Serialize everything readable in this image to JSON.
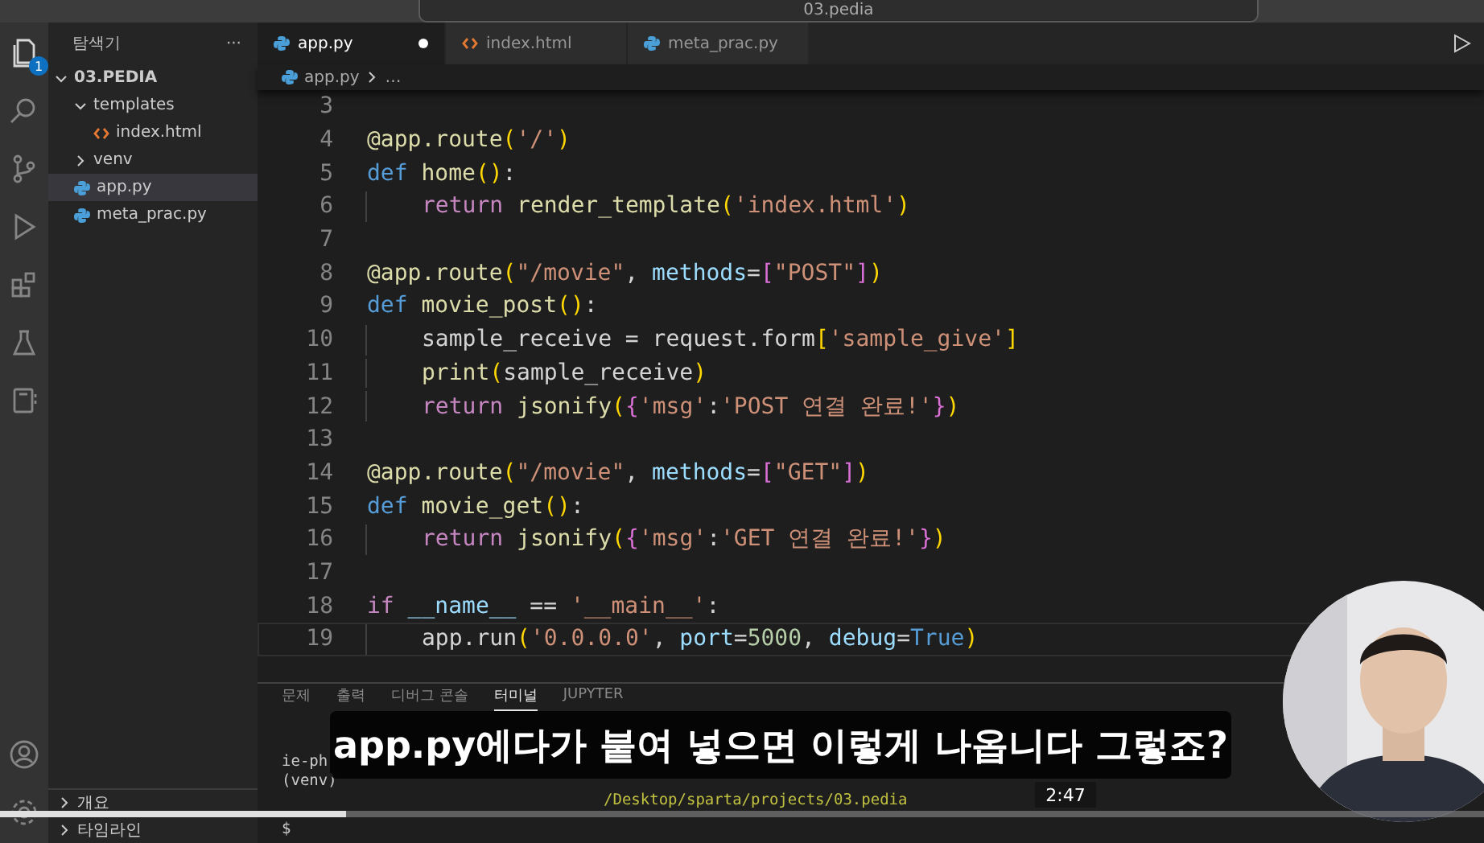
{
  "search": {
    "text": "03.pedia"
  },
  "activity_bar": {
    "badge": "1"
  },
  "explorer": {
    "title": "탐색기",
    "more": "···",
    "tree": [
      {
        "label": "03.PEDIA",
        "kind": "root",
        "expanded": true,
        "selected": false,
        "children": [
          {
            "label": "templates",
            "kind": "folder",
            "expanded": true,
            "selected": false,
            "children": [
              {
                "label": "index.html",
                "kind": "html",
                "selected": false
              }
            ]
          },
          {
            "label": "venv",
            "kind": "folder",
            "expanded": false,
            "selected": false
          },
          {
            "label": "app.py",
            "kind": "python",
            "selected": true
          },
          {
            "label": "meta_prac.py",
            "kind": "python",
            "selected": false
          }
        ]
      }
    ],
    "sections": [
      {
        "label": "개요"
      },
      {
        "label": "타임라인"
      }
    ]
  },
  "tabs": [
    {
      "label": "app.py",
      "kind": "python",
      "selected": true,
      "modified": true
    },
    {
      "label": "index.html",
      "kind": "html",
      "selected": false,
      "modified": false
    },
    {
      "label": "meta_prac.py",
      "kind": "python",
      "selected": false,
      "modified": false
    }
  ],
  "breadcrumb": {
    "file": "app.py",
    "rest": "…"
  },
  "code": [
    {
      "number": "3",
      "indent": false,
      "current": false
    },
    {
      "number": "4",
      "indent": false,
      "current": false,
      "tokens": [
        {
          "kind": "func",
          "text": "@app.route"
        },
        {
          "kind": "bracket",
          "text": "("
        },
        {
          "kind": "string",
          "text": "'/'"
        },
        {
          "kind": "bracket",
          "text": ")"
        }
      ]
    },
    {
      "number": "5",
      "indent": false,
      "current": false,
      "tokens": [
        {
          "kind": "keyword",
          "text": "def "
        },
        {
          "kind": "func",
          "text": "home"
        },
        {
          "kind": "bracket",
          "text": "()"
        },
        {
          "kind": "plain",
          "text": ":"
        }
      ]
    },
    {
      "number": "6",
      "indent": true,
      "current": false,
      "tokens": [
        {
          "kind": "control",
          "text": "return "
        },
        {
          "kind": "func",
          "text": "render_template"
        },
        {
          "kind": "bracket",
          "text": "("
        },
        {
          "kind": "string",
          "text": "'index.html'"
        },
        {
          "kind": "bracket",
          "text": ")"
        }
      ]
    },
    {
      "number": "7",
      "indent": false,
      "current": false
    },
    {
      "number": "8",
      "indent": false,
      "current": false,
      "tokens": [
        {
          "kind": "func",
          "text": "@app.route"
        },
        {
          "kind": "bracket",
          "text": "("
        },
        {
          "kind": "string",
          "text": "\"/movie\""
        },
        {
          "kind": "plain",
          "text": ", "
        },
        {
          "kind": "param",
          "text": "methods"
        },
        {
          "kind": "plain",
          "text": "="
        },
        {
          "kind": "bracket2",
          "text": "["
        },
        {
          "kind": "string",
          "text": "\"POST\""
        },
        {
          "kind": "bracket2",
          "text": "]"
        },
        {
          "kind": "bracket",
          "text": ")"
        }
      ]
    },
    {
      "number": "9",
      "indent": false,
      "current": false,
      "tokens": [
        {
          "kind": "keyword",
          "text": "def "
        },
        {
          "kind": "func",
          "text": "movie_post"
        },
        {
          "kind": "bracket",
          "text": "()"
        },
        {
          "kind": "plain",
          "text": ":"
        }
      ]
    },
    {
      "number": "10",
      "indent": true,
      "current": false,
      "tokens": [
        {
          "kind": "plain",
          "text": "sample_receive = request.form"
        },
        {
          "kind": "bracket",
          "text": "["
        },
        {
          "kind": "string",
          "text": "'sample_give'"
        },
        {
          "kind": "bracket",
          "text": "]"
        }
      ]
    },
    {
      "number": "11",
      "indent": true,
      "current": false,
      "tokens": [
        {
          "kind": "func",
          "text": "print"
        },
        {
          "kind": "bracket",
          "text": "("
        },
        {
          "kind": "plain",
          "text": "sample_receive"
        },
        {
          "kind": "bracket",
          "text": ")"
        }
      ]
    },
    {
      "number": "12",
      "indent": true,
      "current": false,
      "tokens": [
        {
          "kind": "control",
          "text": "return "
        },
        {
          "kind": "func",
          "text": "jsonify"
        },
        {
          "kind": "bracket",
          "text": "("
        },
        {
          "kind": "bracket2",
          "text": "{"
        },
        {
          "kind": "string",
          "text": "'msg'"
        },
        {
          "kind": "plain",
          "text": ":"
        },
        {
          "kind": "string",
          "text": "'POST 연결 완료!'"
        },
        {
          "kind": "bracket2",
          "text": "}"
        },
        {
          "kind": "bracket",
          "text": ")"
        }
      ]
    },
    {
      "number": "13",
      "indent": false,
      "current": false
    },
    {
      "number": "14",
      "indent": false,
      "current": false,
      "tokens": [
        {
          "kind": "func",
          "text": "@app.route"
        },
        {
          "kind": "bracket",
          "text": "("
        },
        {
          "kind": "string",
          "text": "\"/movie\""
        },
        {
          "kind": "plain",
          "text": ", "
        },
        {
          "kind": "param",
          "text": "methods"
        },
        {
          "kind": "plain",
          "text": "="
        },
        {
          "kind": "bracket2",
          "text": "["
        },
        {
          "kind": "string",
          "text": "\"GET\""
        },
        {
          "kind": "bracket2",
          "text": "]"
        },
        {
          "kind": "bracket",
          "text": ")"
        }
      ]
    },
    {
      "number": "15",
      "indent": false,
      "current": false,
      "tokens": [
        {
          "kind": "keyword",
          "text": "def "
        },
        {
          "kind": "func",
          "text": "movie_get"
        },
        {
          "kind": "bracket",
          "text": "()"
        },
        {
          "kind": "plain",
          "text": ":"
        }
      ]
    },
    {
      "number": "16",
      "indent": true,
      "current": false,
      "tokens": [
        {
          "kind": "control",
          "text": "return "
        },
        {
          "kind": "func",
          "text": "jsonify"
        },
        {
          "kind": "bracket",
          "text": "("
        },
        {
          "kind": "bracket2",
          "text": "{"
        },
        {
          "kind": "string",
          "text": "'msg'"
        },
        {
          "kind": "plain",
          "text": ":"
        },
        {
          "kind": "string",
          "text": "'GET 연결 완료!'"
        },
        {
          "kind": "bracket2",
          "text": "}"
        },
        {
          "kind": "bracket",
          "text": ")"
        }
      ]
    },
    {
      "number": "17",
      "indent": false,
      "current": false
    },
    {
      "number": "18",
      "indent": false,
      "current": false,
      "tokens": [
        {
          "kind": "control",
          "text": "if "
        },
        {
          "kind": "param",
          "text": "__name__"
        },
        {
          "kind": "plain",
          "text": " == "
        },
        {
          "kind": "string",
          "text": "'__main__'"
        },
        {
          "kind": "plain",
          "text": ":"
        }
      ]
    },
    {
      "number": "19",
      "indent": true,
      "current": true,
      "tokens": [
        {
          "kind": "plain",
          "text": "app.run"
        },
        {
          "kind": "bracket",
          "text": "("
        },
        {
          "kind": "string",
          "text": "'0.0.0.0'"
        },
        {
          "kind": "plain",
          "text": ", "
        },
        {
          "kind": "param",
          "text": "port"
        },
        {
          "kind": "plain",
          "text": "="
        },
        {
          "kind": "number",
          "text": "5000"
        },
        {
          "kind": "plain",
          "text": ", "
        },
        {
          "kind": "param",
          "text": "debug"
        },
        {
          "kind": "plain",
          "text": "="
        },
        {
          "kind": "keyword",
          "text": "True"
        },
        {
          "kind": "bracket",
          "text": ")"
        }
      ]
    }
  ],
  "panel": {
    "tabs": [
      {
        "label": "문제",
        "selected": false
      },
      {
        "label": "출력",
        "selected": false
      },
      {
        "label": "디버그 콘솔",
        "selected": false
      },
      {
        "label": "터미널",
        "selected": true
      },
      {
        "label": "JUPYTER",
        "selected": false
      }
    ],
    "terminal": [
      {
        "kind": "plain",
        "text": "ie-ph"
      },
      {
        "kind": "plain",
        "text": "(venv)"
      },
      {
        "kind": "path",
        "text": "/Desktop/sparta/projects/03.pedia"
      },
      {
        "kind": "prompt",
        "text": "$"
      }
    ]
  },
  "video": {
    "subtitle": "app.py에다가 붙여 넣으면 이렇게 나옵니다 그렇죠?",
    "time": "2:47",
    "progress": {
      "level": 0.233
    }
  }
}
